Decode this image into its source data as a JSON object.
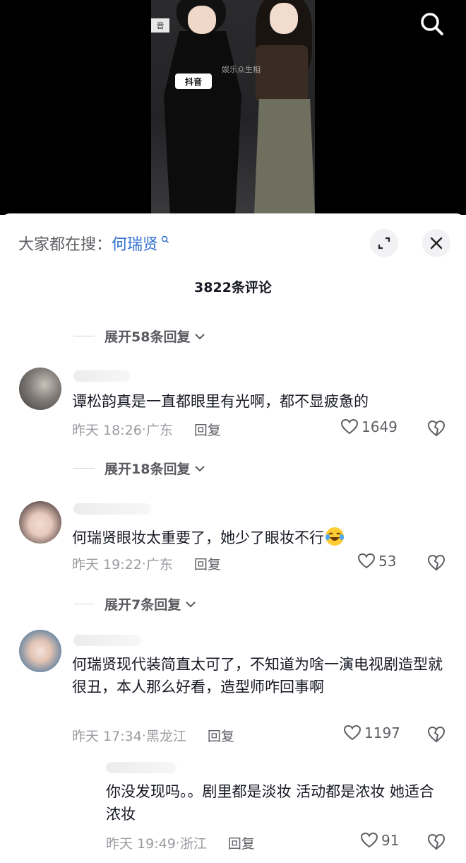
{
  "video": {
    "mic_badge": "抖音",
    "tag": "音",
    "watermark": "娱乐众生相"
  },
  "sheet": {
    "search_prefix": "大家都在搜：",
    "search_term": "何瑞贤",
    "comment_count": "3822条评论"
  },
  "threads": [
    {
      "expand_label": "展开58条回复",
      "comment": {
        "text": "谭松韵真是一直都眼里有光啊，都不显疲惫的",
        "time": "昨天 18:26",
        "location": "广东",
        "reply": "回复",
        "likes": "1649"
      }
    },
    {
      "expand_label": "展开18条回复",
      "comment": {
        "text": "何瑞贤眼妆太重要了，她少了眼妆不行",
        "time": "昨天 19:22",
        "location": "广东",
        "reply": "回复",
        "likes": "53"
      }
    },
    {
      "expand_label": "展开7条回复",
      "comment": {
        "text": "何瑞贤现代装简直太可了，不知道为啥一演电视剧造型就很丑，本人那么好看，造型师咋回事啊",
        "time": "昨天 17:34",
        "location": "黑龙江",
        "reply": "回复",
        "likes": "1197"
      }
    }
  ],
  "sub_reply": {
    "text": "你没发现吗。。剧里都是淡妆 活动都是浓妆 她适合浓妆",
    "time": "昨天 19:49",
    "location": "浙江",
    "reply": "回复",
    "likes": "91"
  },
  "separator": "·",
  "colors": {
    "accent": "#2f6fd0",
    "text_primary": "#161823",
    "text_secondary": "#9a9aa0"
  },
  "icons": [
    "search-icon",
    "expand-icon",
    "close-icon",
    "chevron-down-icon",
    "heart-icon",
    "broken-heart-icon",
    "laughing-emoji-icon"
  ]
}
